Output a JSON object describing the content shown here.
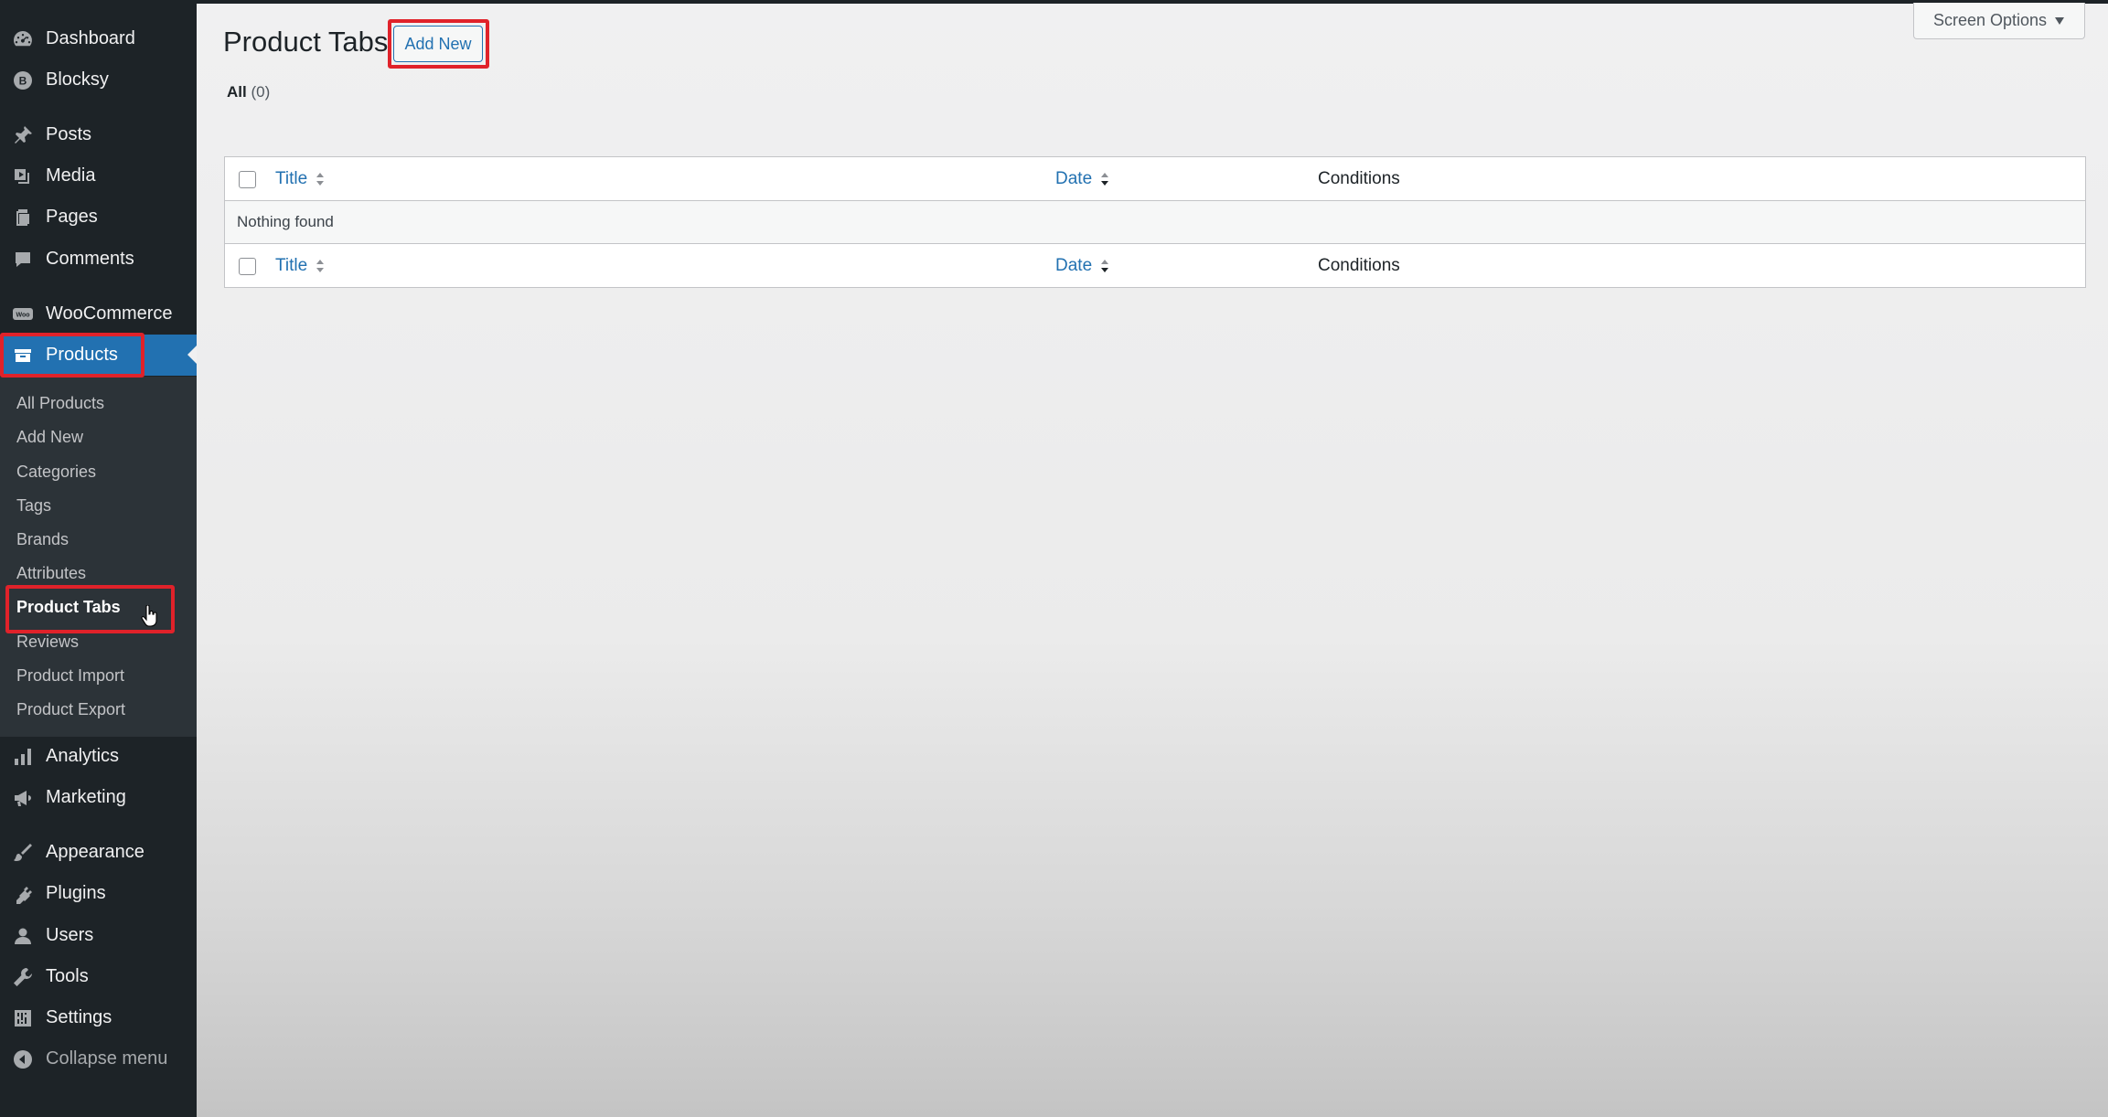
{
  "sidebar": {
    "items": [
      {
        "label": "Dashboard",
        "icon": "dashboard-icon"
      },
      {
        "label": "Blocksy",
        "icon": "blocksy-icon"
      },
      {
        "label": "Posts",
        "icon": "pin-icon"
      },
      {
        "label": "Media",
        "icon": "media-icon"
      },
      {
        "label": "Pages",
        "icon": "page-icon"
      },
      {
        "label": "Comments",
        "icon": "comment-icon"
      },
      {
        "label": "WooCommerce",
        "icon": "woo-icon",
        "icon_text": "Woo"
      },
      {
        "label": "Products",
        "icon": "archive-icon",
        "active": true
      },
      {
        "label": "Analytics",
        "icon": "bar-chart-icon"
      },
      {
        "label": "Marketing",
        "icon": "megaphone-icon"
      },
      {
        "label": "Appearance",
        "icon": "brush-icon"
      },
      {
        "label": "Plugins",
        "icon": "plug-icon"
      },
      {
        "label": "Users",
        "icon": "user-icon"
      },
      {
        "label": "Tools",
        "icon": "wrench-icon"
      },
      {
        "label": "Settings",
        "icon": "settings-icon"
      }
    ],
    "submenu": [
      "All Products",
      "Add New",
      "Categories",
      "Tags",
      "Brands",
      "Attributes",
      "Product Tabs",
      "Reviews",
      "Product Import",
      "Product Export"
    ],
    "current_submenu": "Product Tabs",
    "collapse_label": "Collapse menu"
  },
  "header": {
    "title": "Product Tabs",
    "add_new_label": "Add New",
    "screen_options_label": "Screen Options"
  },
  "filters": {
    "all_label": "All",
    "all_count": "(0)"
  },
  "table": {
    "columns": {
      "title": "Title",
      "date": "Date",
      "conditions": "Conditions"
    },
    "empty_message": "Nothing found"
  },
  "colors": {
    "accent": "#2271b1",
    "sidebar_bg": "#1d2327",
    "submenu_bg": "#2c3338",
    "highlight": "#e0222a"
  }
}
